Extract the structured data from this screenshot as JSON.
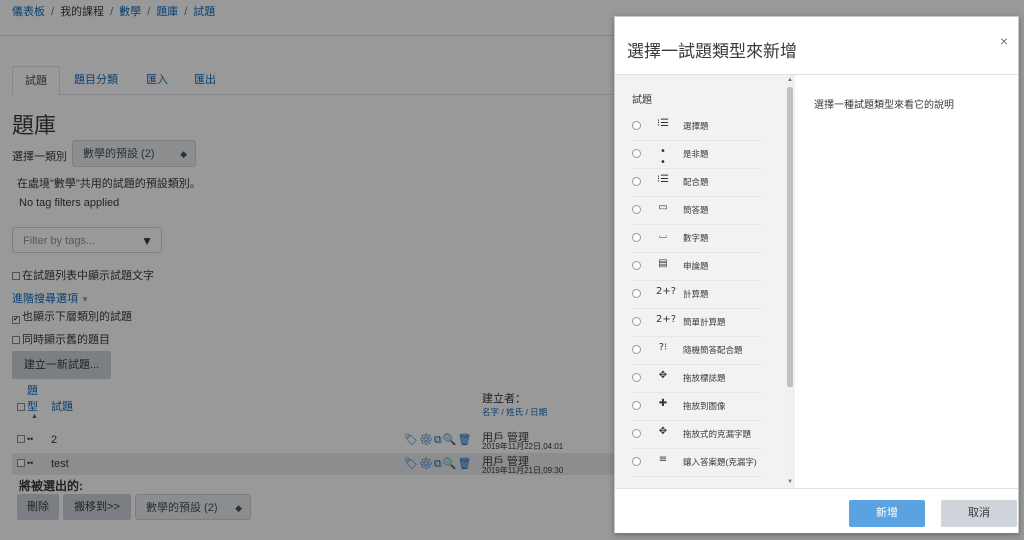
{
  "breadcrumb": {
    "items": [
      "儀表板",
      "我的課程",
      "數學",
      "題庫",
      "試題"
    ]
  },
  "tabs": [
    "試題",
    "題目分類",
    "匯入",
    "匯出"
  ],
  "page": {
    "title": "題庫",
    "category_label": "選擇一類別",
    "category_value": "數學的預設 (2)",
    "category_desc": "在處境\"數學\"共用的試題的預設類別。",
    "tag_status": "No tag filters applied",
    "tag_placeholder": "Filter by tags...",
    "show_text_label": "在試題列表中顯示試題文字",
    "advanced_search": "進階搜尋選項",
    "show_subcat_label": "也顯示下層類別的試題",
    "show_old_label": "同時顯示舊的題目",
    "create_button": "建立一新試題...",
    "col_type_1": "題",
    "col_type_2": "型",
    "col_question": "試題",
    "col_creator": "建立者：",
    "col_creator_sort": "名字 / 姓氏 / 日期",
    "rows": [
      {
        "name": "2",
        "user": "用戶 管理",
        "date": "2019年11月22日,04:01"
      },
      {
        "name": "test",
        "user": "用戶 管理",
        "date": "2019年11月21日,09:30"
      }
    ],
    "selected_label": "將被選出的:",
    "delete_button": "刪除",
    "move_button": "搬移到>>",
    "move_target": "數學的預設 (2)"
  },
  "modal": {
    "title": "選擇一試題類型來新增",
    "close": "×",
    "section": "試題",
    "description": "選擇一種試題類型來看它的說明",
    "options": [
      {
        "label": "選擇題",
        "icon": "list-icon",
        "glyph": "⁝☰"
      },
      {
        "label": "是非題",
        "icon": "dots-icon",
        "glyph": "• •"
      },
      {
        "label": "配合題",
        "icon": "matching-icon",
        "glyph": "⁝☰"
      },
      {
        "label": "簡答題",
        "icon": "textbox-icon",
        "glyph": "▭"
      },
      {
        "label": "數字題",
        "icon": "numeric-icon",
        "glyph": "⌴"
      },
      {
        "label": "申論題",
        "icon": "essay-icon",
        "glyph": "▤"
      },
      {
        "label": "計算題",
        "icon": "calculated-icon",
        "glyph": "2+?"
      },
      {
        "label": "簡單計算題",
        "icon": "simple-calc-icon",
        "glyph": "2+?"
      },
      {
        "label": "隨機簡答配合題",
        "icon": "random-match-icon",
        "glyph": "?⁝"
      },
      {
        "label": "拖放標誌題",
        "icon": "drag-marker-icon",
        "glyph": "✥"
      },
      {
        "label": "拖放到圖像",
        "icon": "drag-image-icon",
        "glyph": "✚"
      },
      {
        "label": "拖放式的克漏字題",
        "icon": "drag-text-icon",
        "glyph": "✥"
      },
      {
        "label": "鑲入答案題(克漏字)",
        "icon": "cloze-icon",
        "glyph": "≡"
      }
    ],
    "add_button": "新增",
    "cancel_button": "取消"
  },
  "colors": {
    "link": "#0f6cbf",
    "primary": "#5aa3e0",
    "secondary": "#ced4da"
  }
}
